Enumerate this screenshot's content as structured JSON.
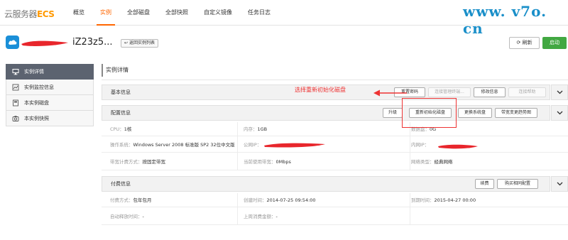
{
  "brand": {
    "prefix": "云服务器",
    "suffix": "ECS"
  },
  "nav": [
    {
      "label": "概览",
      "active": false
    },
    {
      "label": "实例",
      "active": true
    },
    {
      "label": "全部磁盘",
      "active": false
    },
    {
      "label": "全部快照",
      "active": false
    },
    {
      "label": "自定义镜像",
      "active": false
    },
    {
      "label": "任务日志",
      "active": false
    }
  ],
  "watermark": "www. v7o. cn",
  "instance": {
    "title": "iZ23z5...",
    "back_label": "返回实例列表"
  },
  "actions": {
    "refresh": "刷新",
    "start": "启动"
  },
  "sidebar": [
    {
      "label": "实例详情",
      "icon": "monitor-icon",
      "active": true
    },
    {
      "label": "实例监控信息",
      "icon": "chart-icon",
      "active": false
    },
    {
      "label": "本实例磁盘",
      "icon": "disk-icon",
      "active": false
    },
    {
      "label": "本实例快照",
      "icon": "snapshot-icon",
      "active": false
    }
  ],
  "main_title": "实例详情",
  "basic": {
    "title": "基本信息",
    "buttons": {
      "reset_password": "重置密码",
      "management": "连接管理终端...",
      "modify": "修改信息",
      "help": "连接帮助"
    }
  },
  "config": {
    "title": "配置信息",
    "buttons": {
      "upgrade": "升级",
      "reinit_disk": "重新初始化磁盘",
      "change_os": "更换系统盘",
      "bandwidth": "带宽变更趋势图"
    },
    "rows": [
      [
        {
          "label": "CPU：",
          "value": "1核"
        },
        {
          "label": "内存：",
          "value": "1GB"
        },
        {
          "label": "数据盘：",
          "value": "0G"
        }
      ],
      [
        {
          "label": "操作系统：",
          "value": "Windows Server 2008 标准版 SP2 32位中文版"
        },
        {
          "label": "公网IP：",
          "value": ""
        },
        {
          "label": "内网IP：",
          "value": ""
        }
      ],
      [
        {
          "label": "带宽计费方式：",
          "value": "按固定带宽"
        },
        {
          "label": "当前使用带宽：",
          "value": "0Mbps"
        },
        {
          "label": "网络类型：",
          "value": "经典网络"
        }
      ]
    ]
  },
  "billing": {
    "title": "付费信息",
    "buttons": {
      "renew": "续费",
      "buy_same": "购买相同配置"
    },
    "rows": [
      [
        {
          "label": "付费方式：",
          "value": "包年包月"
        },
        {
          "label": "创建时间：",
          "value": "2014-07-25 09:54:00"
        },
        {
          "label": "到期时间：",
          "value": "2015-04-27 00:00"
        }
      ],
      [
        {
          "label": "自动释放时间：",
          "value": "-"
        },
        {
          "label": "上周消费金额：",
          "value": "-"
        },
        {
          "label": "",
          "value": ""
        }
      ]
    ]
  },
  "annotation": "选择重新初始化磁盘",
  "colors": {
    "accent": "#ff6600",
    "annotation": "#e33333",
    "start": "#42a842",
    "sidebar_active": "#5c6370"
  }
}
